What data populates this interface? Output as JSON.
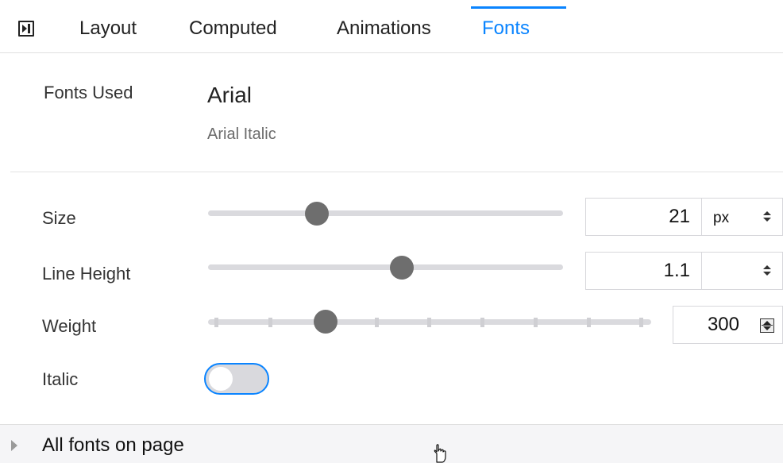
{
  "tabs": [
    {
      "label": "Layout"
    },
    {
      "label": "Computed"
    },
    {
      "label": "Animations"
    },
    {
      "label": "Fonts"
    }
  ],
  "active_tab": "Fonts",
  "accent_color": "#0a84ff",
  "fonts_used": {
    "label": "Fonts Used",
    "primary": "Arial",
    "secondary": "Arial Italic"
  },
  "controls": {
    "size": {
      "label": "Size",
      "value": "21",
      "unit": "px"
    },
    "line_height": {
      "label": "Line Height",
      "value": "1.1",
      "unit": ""
    },
    "weight": {
      "label": "Weight",
      "value": "300"
    },
    "italic": {
      "label": "Italic",
      "checked": false
    }
  },
  "all_fonts": {
    "label": "All fonts on page",
    "expanded": false
  },
  "icons": [
    "sidebar-toggle-icon",
    "up-down-arrow-icon",
    "spin-button-icon",
    "disclosure-triangle-icon",
    "hand-cursor-icon"
  ]
}
